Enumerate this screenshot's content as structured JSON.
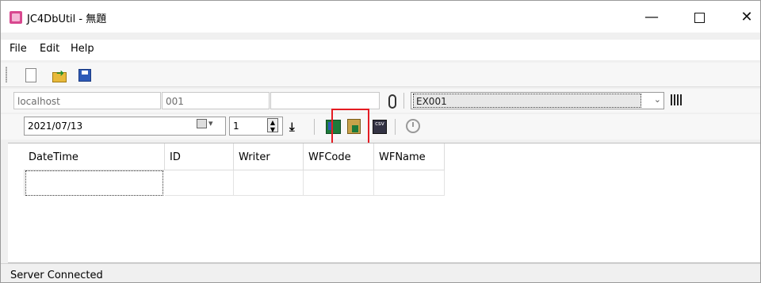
{
  "window": {
    "title": "JC4DbUtil - 無題"
  },
  "menu": {
    "items": [
      "File",
      "Edit",
      "Help"
    ]
  },
  "connection": {
    "host": "localhost",
    "port": "001",
    "extra": "",
    "schema": "EX001"
  },
  "query": {
    "date": "2021/07/13",
    "count": "1"
  },
  "grid": {
    "columns": [
      "DateTime",
      "ID",
      "Writer",
      "WFCode",
      "WFName"
    ]
  },
  "status": {
    "text": "Server Connected"
  },
  "colors": {
    "highlight": "#e41c23",
    "excel": "#1d7a3a",
    "disk": "#2d5ab8"
  }
}
